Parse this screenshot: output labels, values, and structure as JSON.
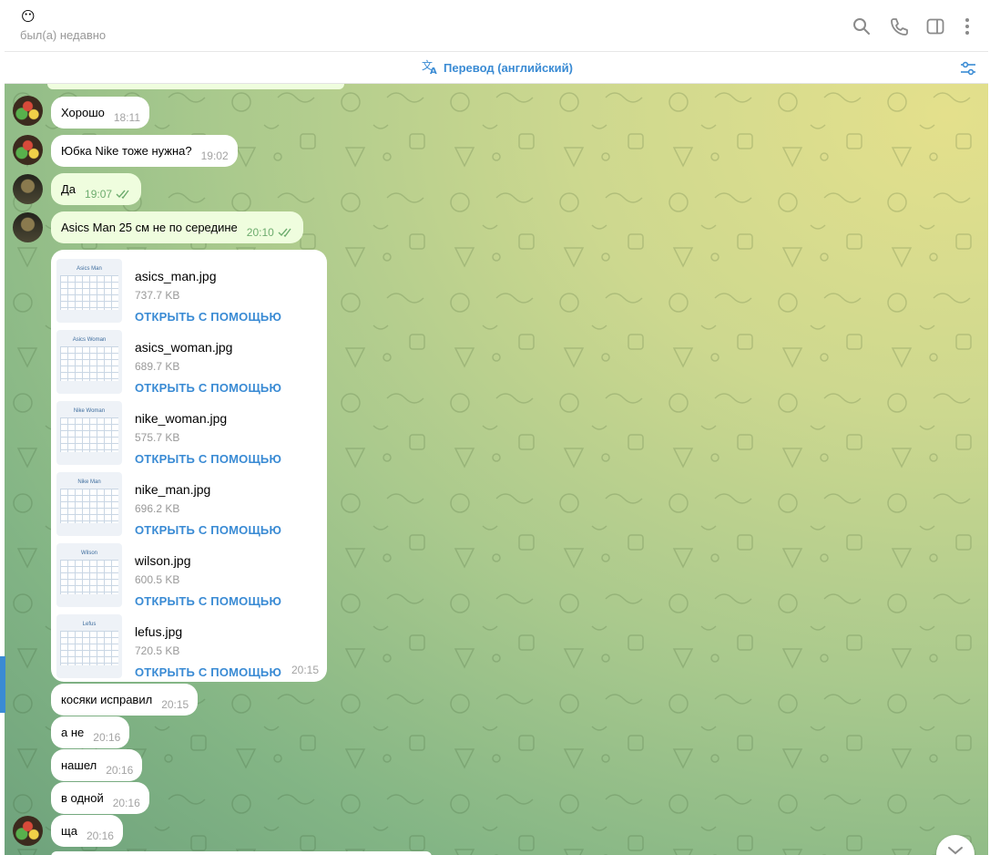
{
  "header": {
    "emoji": "😶",
    "status": "был(а) недавно",
    "icons": [
      "search-icon",
      "phone-icon",
      "sidebar-icon",
      "more-icon"
    ]
  },
  "translate": {
    "label": "Перевод (английский)"
  },
  "colors": {
    "accent": "#3a8bd4",
    "outgoing": "#effdde",
    "incoming": "#ffffff"
  },
  "messages": [
    {
      "text": "Хорошо",
      "time": "18:11"
    },
    {
      "text": "Юбка Nike тоже нужна?",
      "time": "19:02"
    },
    {
      "text": "Да",
      "time": "19:07"
    },
    {
      "text": "Asics Man 25 см не по середине",
      "time": "20:10"
    }
  ],
  "files": {
    "time": "20:15",
    "open_label": "ОТКРЫТЬ С ПОМОЩЬЮ",
    "items": [
      {
        "name": "asics_man.jpg",
        "size": "737.7 KB",
        "thumb": "Asics Man"
      },
      {
        "name": "asics_woman.jpg",
        "size": "689.7 KB",
        "thumb": "Asics Woman"
      },
      {
        "name": "nike_woman.jpg",
        "size": "575.7 KB",
        "thumb": "Nike Woman"
      },
      {
        "name": "nike_man.jpg",
        "size": "696.2 KB",
        "thumb": "Nike Man"
      },
      {
        "name": "wilson.jpg",
        "size": "600.5 KB",
        "thumb": "Wilson"
      },
      {
        "name": "lefus.jpg",
        "size": "720.5 KB",
        "thumb": "Lefus"
      }
    ]
  },
  "later_messages": [
    {
      "text": "косяки исправил",
      "time": "20:15"
    },
    {
      "text": "а не",
      "time": "20:16"
    },
    {
      "text": "нашел",
      "time": "20:16"
    },
    {
      "text": "в одной",
      "time": "20:16"
    },
    {
      "text": "ща",
      "time": "20:16"
    }
  ]
}
